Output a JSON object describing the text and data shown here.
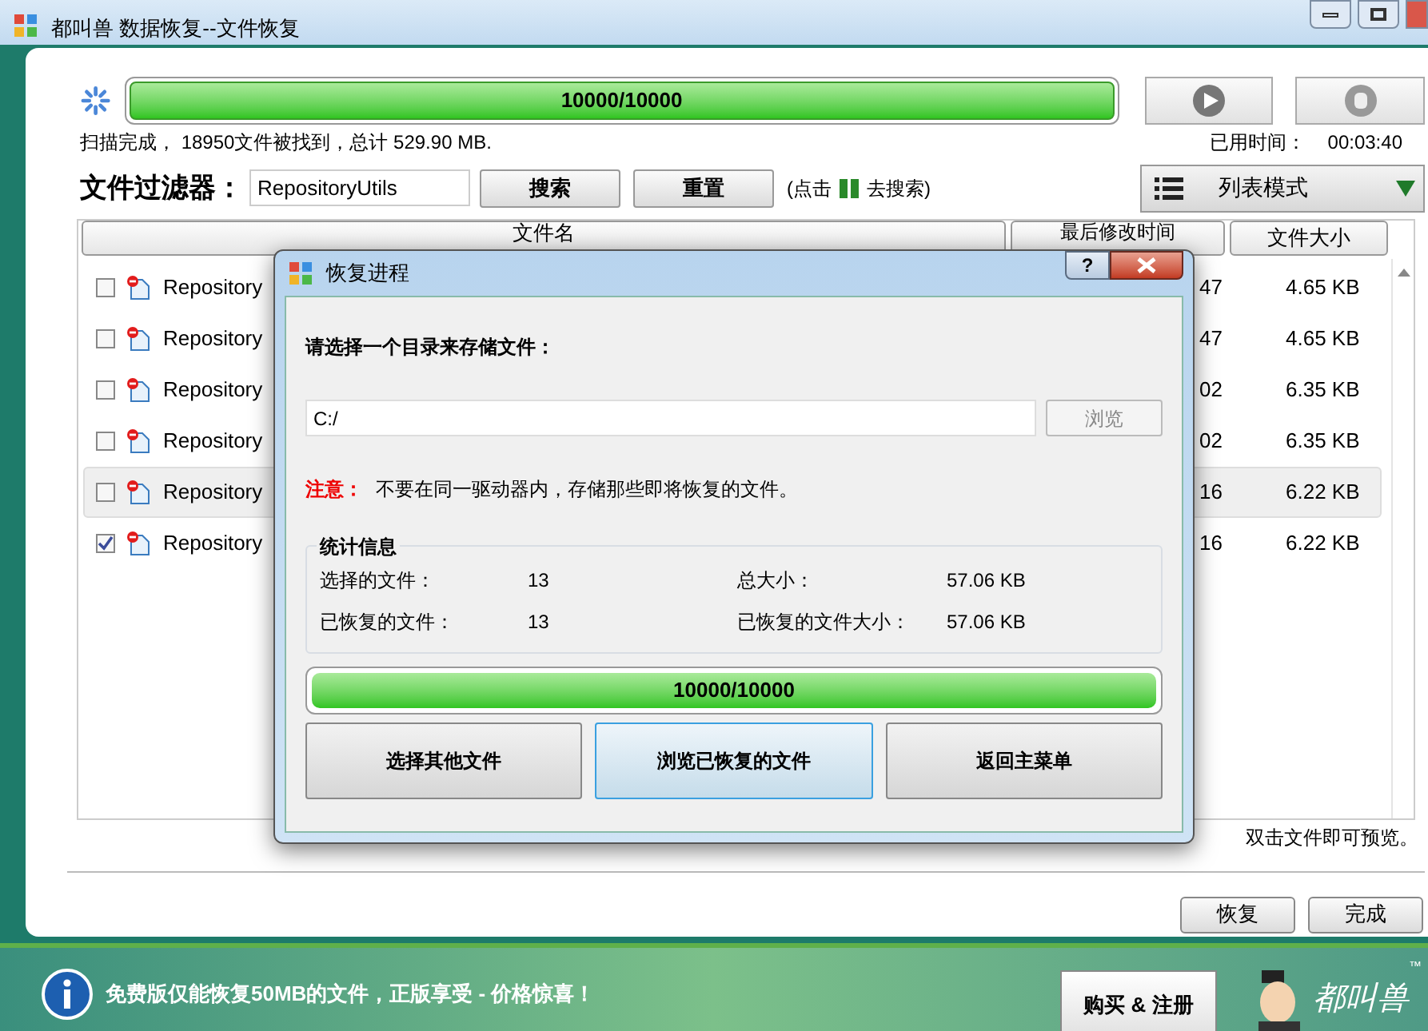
{
  "window": {
    "title": "都叫兽 数据恢复--文件恢复"
  },
  "scan": {
    "progress_label": "10000/10000",
    "level": 1,
    "summary": "扫描完成， 18950文件被找到，总计 529.90 MB.",
    "elapsed_label": "已用时间：",
    "elapsed": "00:03:40"
  },
  "filter": {
    "label": "文件过滤器：",
    "value": "RepositoryUtils",
    "buttons": [
      "搜索",
      "重置"
    ],
    "hint_before": "(点击",
    "hint_after": "去搜索)"
  },
  "view_mode": {
    "label": "列表模式"
  },
  "table": {
    "columns": [
      "文件名",
      "最后修改时间",
      "文件大小"
    ],
    "rows": [
      {
        "name": "Repository",
        "time": "47",
        "size": "4.65 KB",
        "checked": false,
        "selected": false
      },
      {
        "name": "Repository",
        "time": "47",
        "size": "4.65 KB",
        "checked": false,
        "selected": false
      },
      {
        "name": "Repository",
        "time": "02",
        "size": "6.35 KB",
        "checked": false,
        "selected": false
      },
      {
        "name": "Repository",
        "time": "02",
        "size": "6.35 KB",
        "checked": false,
        "selected": false
      },
      {
        "name": "Repository",
        "time": "16",
        "size": "6.22 KB",
        "checked": false,
        "selected": true
      },
      {
        "name": "Repository",
        "time": "16",
        "size": "6.22 KB",
        "checked": true,
        "selected": false
      }
    ]
  },
  "preview_hint": "双击文件即可预览。",
  "footer_buttons": [
    "恢复",
    "完成"
  ],
  "banner": {
    "text": "免费版仅能恢复50MB的文件，正版享受 - 价格惊喜！",
    "button": "购买 & 注册",
    "logo": "都叫兽",
    "trademark": "™"
  },
  "dialog": {
    "title": "恢复进程",
    "help": "?",
    "prompt": "请选择一个目录来存储文件：",
    "path": "C:/",
    "browse": {
      "label": "浏览",
      "disabled": true
    },
    "note_label": "注意：",
    "note": "不要在同一驱动器内，存储那些即将恢复的文件。",
    "stats_title": "统计信息",
    "stats": [
      {
        "label": "选择的文件：",
        "value": "13"
      },
      {
        "label": "总大小：",
        "value": "57.06 KB"
      },
      {
        "label": "已恢复的文件：",
        "value": "13"
      },
      {
        "label": "已恢复的文件大小：",
        "value": "57.06 KB"
      }
    ],
    "progress_label": "10000/10000",
    "level": 1,
    "buttons": [
      {
        "label": "选择其他文件",
        "selected": false
      },
      {
        "label": "浏览已恢复的文件",
        "selected": true
      },
      {
        "label": "返回主菜单",
        "selected": false
      }
    ]
  }
}
